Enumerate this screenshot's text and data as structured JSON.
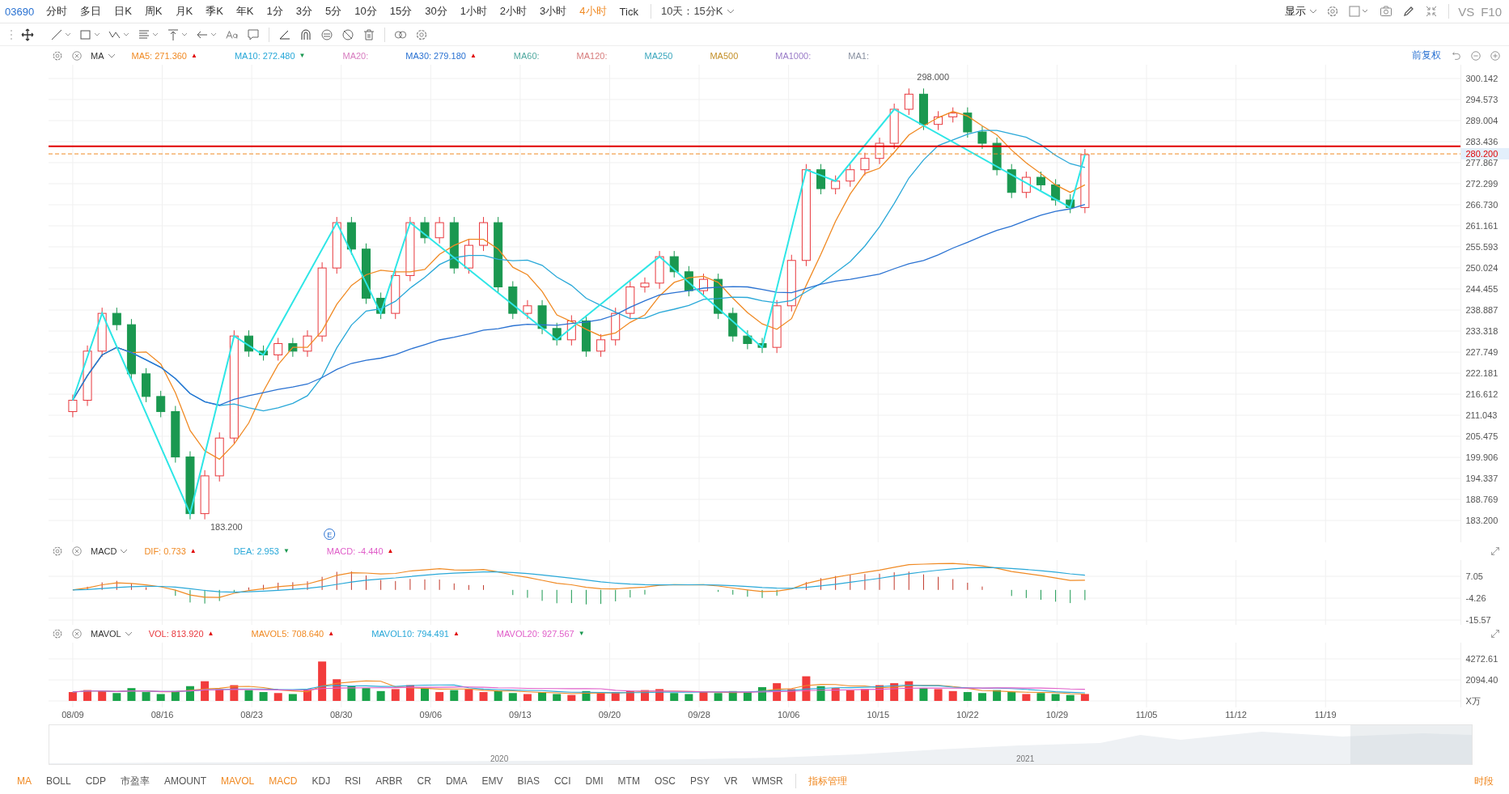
{
  "top_bar": {
    "ticker": "03690",
    "periods": [
      {
        "label": "分时",
        "selected": false
      },
      {
        "label": "多日",
        "selected": false
      },
      {
        "label": "日K",
        "selected": false
      },
      {
        "label": "周K",
        "selected": false
      },
      {
        "label": "月K",
        "selected": false
      },
      {
        "label": "季K",
        "selected": false
      },
      {
        "label": "年K",
        "selected": false
      },
      {
        "label": "1分",
        "selected": false
      },
      {
        "label": "3分",
        "selected": false
      },
      {
        "label": "5分",
        "selected": false
      },
      {
        "label": "10分",
        "selected": false
      },
      {
        "label": "15分",
        "selected": false
      },
      {
        "label": "30分",
        "selected": false
      },
      {
        "label": "1小时",
        "selected": false
      },
      {
        "label": "2小时",
        "selected": false
      },
      {
        "label": "3小时",
        "selected": false
      },
      {
        "label": "4小时",
        "selected": true
      },
      {
        "label": "Tick",
        "selected": false
      }
    ],
    "range_select": "10天：15分K",
    "display_menu": "显示",
    "compare": "VS",
    "f10": "F10"
  },
  "ma_legend": {
    "name": "MA",
    "items": [
      {
        "label": "MA5: 271.360",
        "color": "#f08a24",
        "marker": {
          "symbol": "▲",
          "color": "#e00000"
        }
      },
      {
        "label": "MA10: 272.480",
        "color": "#29a8d8",
        "marker": {
          "symbol": "▼",
          "color": "#1a9850"
        }
      },
      {
        "label": "MA20:",
        "color": "#d77cbf"
      },
      {
        "label": "MA30: 279.180",
        "color": "#2a72d2",
        "marker": {
          "symbol": "▲",
          "color": "#e00000"
        }
      },
      {
        "label": "MA60:",
        "color": "#4fa89f"
      },
      {
        "label": "MA120:",
        "color": "#d77c7c"
      },
      {
        "label": "MA250",
        "color": "#3aa6bd"
      },
      {
        "label": "MA500",
        "color": "#c4902a"
      },
      {
        "label": "MA1000:",
        "color": "#9a7cc8"
      },
      {
        "label": "MA1:",
        "color": "#8890a0"
      }
    ],
    "adjust": "前复权"
  },
  "main_chart": {
    "price_axis": [
      "300.142",
      "294.573",
      "289.004",
      "283.436",
      "277.867",
      "272.299",
      "266.730",
      "261.161",
      "255.593",
      "250.024",
      "244.455",
      "238.887",
      "233.318",
      "227.749",
      "222.181",
      "216.612",
      "211.043",
      "205.475",
      "199.906",
      "194.337",
      "188.769",
      "183.200"
    ],
    "labels": [
      "298.000",
      "183.200",
      "E"
    ],
    "price_tag": "280.200"
  },
  "macd_legend": {
    "name": "MACD",
    "items": [
      {
        "label": "DIF: 0.733",
        "color": "#f08a24",
        "marker": {
          "symbol": "▲",
          "color": "#e00000"
        }
      },
      {
        "label": "DEA: 2.953",
        "color": "#29a8d8",
        "marker": {
          "symbol": "▼",
          "color": "#1a9850"
        }
      },
      {
        "label": "MACD: -4.440",
        "color": "#e05ec9",
        "marker": {
          "symbol": "▲",
          "color": "#e00000"
        }
      }
    ]
  },
  "macd_panel": {
    "axis": [
      "7.05",
      "-4.26",
      "-15.57"
    ]
  },
  "volume_legend": {
    "name": "MAVOL",
    "items": [
      {
        "label": "VOL: 813.920",
        "color": "#e8383d",
        "marker": {
          "symbol": "▲",
          "color": "#e00000"
        }
      },
      {
        "label": "MAVOL5: 708.640",
        "color": "#f08a24",
        "marker": {
          "symbol": "▲",
          "color": "#e00000"
        }
      },
      {
        "label": "MAVOL10: 794.491",
        "color": "#29a8d8",
        "marker": {
          "symbol": "▲",
          "color": "#e00000"
        }
      },
      {
        "label": "MAVOL20: 927.567",
        "color": "#e05ec9",
        "marker": {
          "symbol": "▼",
          "color": "#1a9850"
        }
      }
    ]
  },
  "volume_panel": {
    "axis": [
      "4272.61",
      "2094.40",
      "X万"
    ]
  },
  "date_axis": [
    "08/09",
    "08/16",
    "08/23",
    "08/30",
    "09/06",
    "09/13",
    "09/20",
    "09/28",
    "10/06",
    "10/15",
    "10/22",
    "10/29",
    "11/05",
    "11/12",
    "11/19"
  ],
  "navigator": {
    "labels": [
      "2020",
      "2021"
    ]
  },
  "indicators": [
    {
      "label": "MA",
      "selected": true
    },
    {
      "label": "BOLL",
      "selected": false
    },
    {
      "label": "CDP",
      "selected": false
    },
    {
      "label": "市盈率",
      "selected": false
    },
    {
      "label": "AMOUNT",
      "selected": false
    },
    {
      "label": "MAVOL",
      "selected": true
    },
    {
      "label": "MACD",
      "selected": true
    },
    {
      "label": "KDJ",
      "selected": false
    },
    {
      "label": "RSI",
      "selected": false
    },
    {
      "label": "ARBR",
      "selected": false
    },
    {
      "label": "CR",
      "selected": false
    },
    {
      "label": "DMA",
      "selected": false
    },
    {
      "label": "EMV",
      "selected": false
    },
    {
      "label": "BIAS",
      "selected": false
    },
    {
      "label": "CCI",
      "selected": false
    },
    {
      "label": "DMI",
      "selected": false
    },
    {
      "label": "MTM",
      "selected": false
    },
    {
      "label": "OSC",
      "selected": false
    },
    {
      "label": "PSY",
      "selected": false
    },
    {
      "label": "VR",
      "selected": false
    },
    {
      "label": "WMSR",
      "selected": false
    }
  ],
  "manage_link": "指标管理",
  "session": "时段"
}
